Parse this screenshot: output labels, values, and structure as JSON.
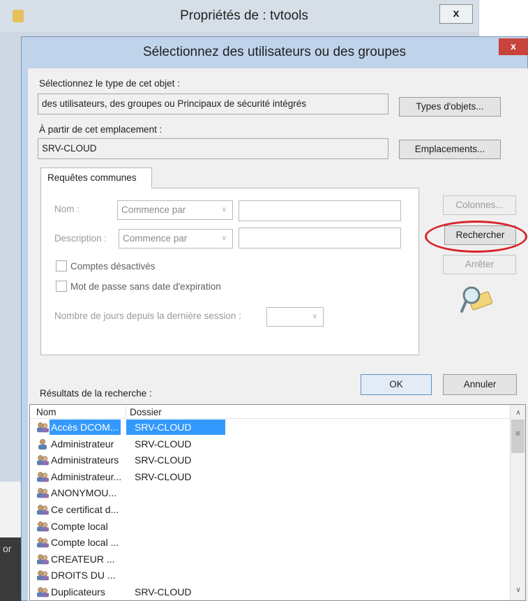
{
  "background_window": {
    "title": "Propriétés de : tvtools",
    "close_label": "x",
    "side_text": "or"
  },
  "dialog": {
    "title": "Sélectionnez des utilisateurs ou des groupes",
    "close_label": "x",
    "object_type": {
      "label": "Sélectionnez le type de cet objet :",
      "value": "des utilisateurs, des groupes ou Principaux de sécurité intégrés",
      "button": "Types d'objets..."
    },
    "location": {
      "label": "À partir de cet emplacement :",
      "value": "SRV-CLOUD",
      "button": "Emplacements..."
    },
    "common_queries": {
      "tab_label": "Requêtes communes",
      "name_label": "Nom :",
      "name_mode": "Commence par",
      "description_label": "Description :",
      "description_mode": "Commence par",
      "disabled_accounts": "Comptes désactivés",
      "non_expiring_password": "Mot de passe sans date d'expiration",
      "days_since_logon": "Nombre de jours depuis la dernière session :"
    },
    "buttons": {
      "columns": "Colonnes...",
      "search": "Rechercher",
      "stop": "Arrêter",
      "ok": "OK",
      "cancel": "Annuler"
    },
    "results": {
      "label": "Résultats de la recherche :",
      "columns": [
        "Nom",
        "Dossier"
      ],
      "rows": [
        {
          "name": "Accès DCOM...",
          "folder": "SRV-CLOUD",
          "icon": "group-icon",
          "selected": true
        },
        {
          "name": "Administrateur",
          "folder": "SRV-CLOUD",
          "icon": "user-icon"
        },
        {
          "name": "Administrateurs",
          "folder": "SRV-CLOUD",
          "icon": "group-icon"
        },
        {
          "name": "Administrateur...",
          "folder": "SRV-CLOUD",
          "icon": "group-icon"
        },
        {
          "name": "ANONYMOU...",
          "folder": "",
          "icon": "group-icon"
        },
        {
          "name": "Ce certificat d...",
          "folder": "",
          "icon": "group-icon"
        },
        {
          "name": "Compte local",
          "folder": "",
          "icon": "group-icon"
        },
        {
          "name": "Compte local ...",
          "folder": "",
          "icon": "group-icon"
        },
        {
          "name": "CREATEUR ...",
          "folder": "",
          "icon": "group-icon"
        },
        {
          "name": "DROITS DU ...",
          "folder": "",
          "icon": "group-icon"
        },
        {
          "name": "Duplicateurs",
          "folder": "SRV-CLOUD",
          "icon": "group-icon"
        }
      ]
    }
  },
  "colors": {
    "selection": "#3399ff",
    "annotation_ring": "#d8232a",
    "dialog_frame": "#bfd3ea"
  }
}
